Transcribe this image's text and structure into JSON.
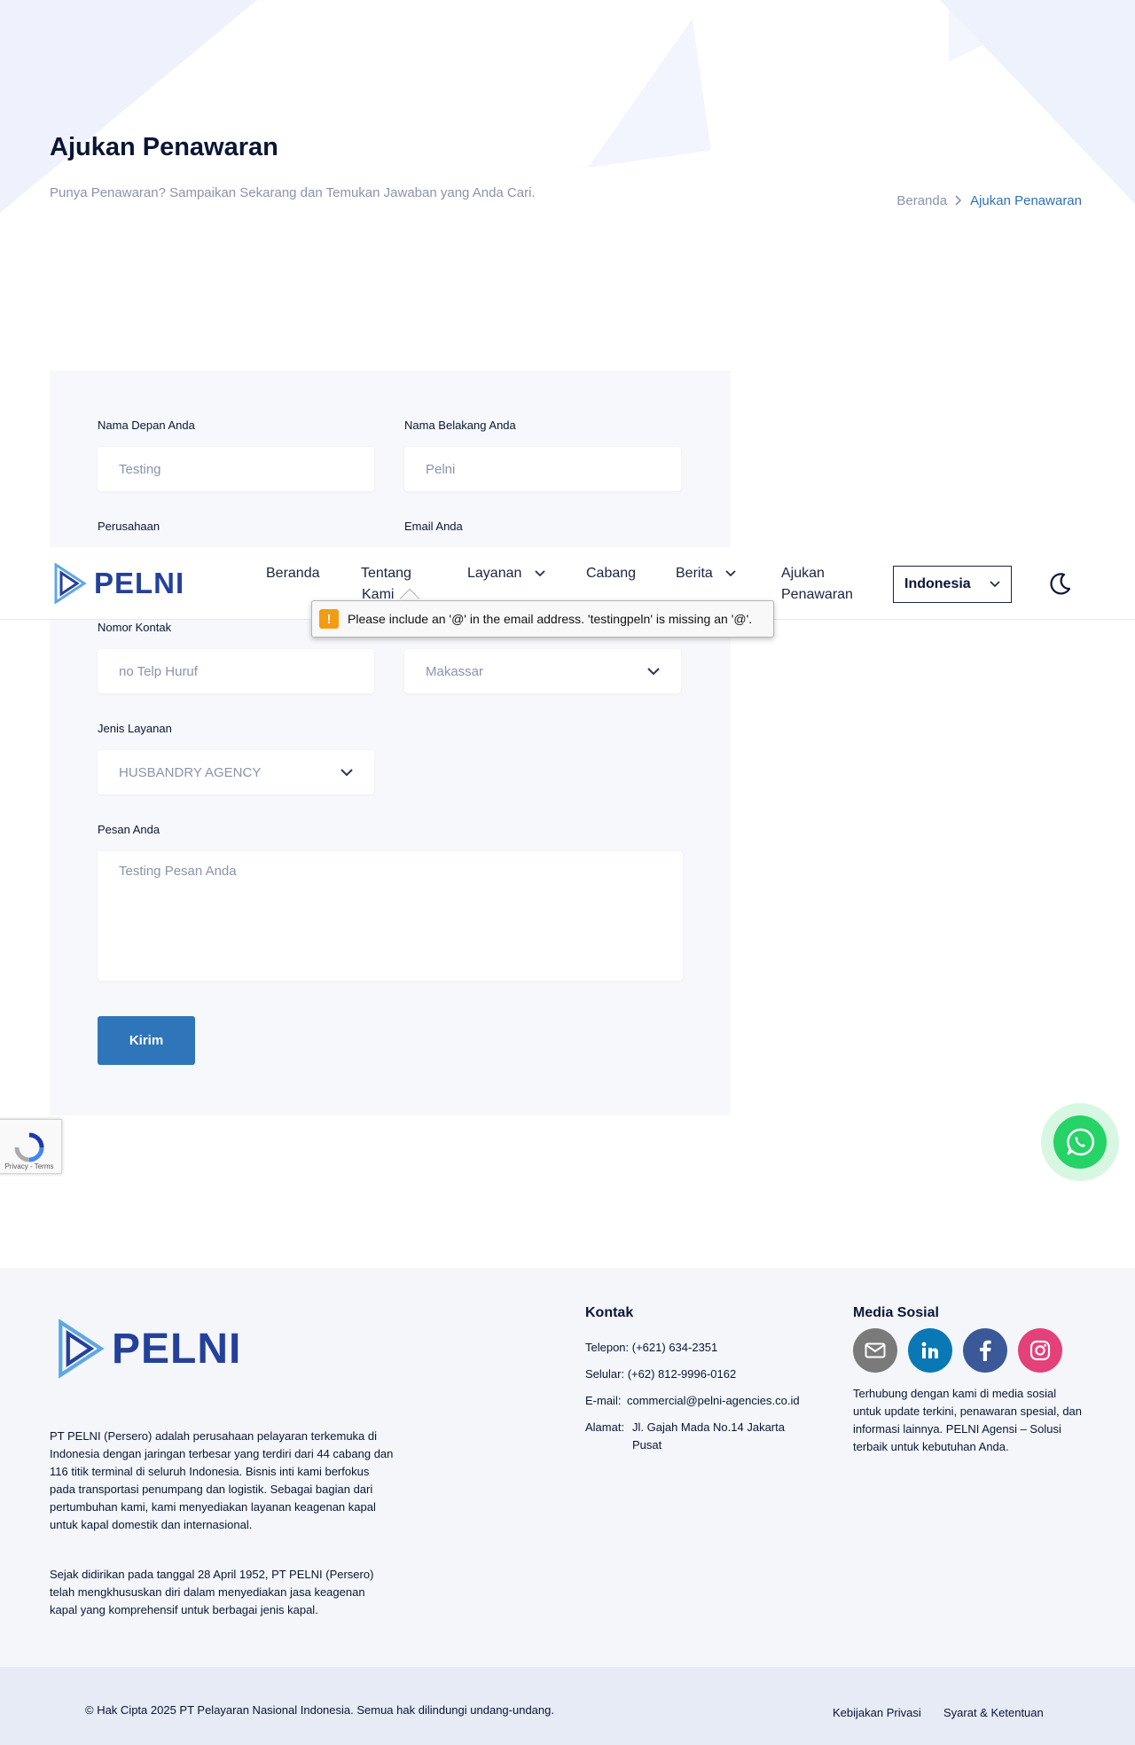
{
  "hero": {
    "title": "Ajukan Penawaran",
    "subtitle": "Punya Penawaran? Sampaikan Sekarang dan Temukan Jawaban yang Anda Cari.",
    "breadcrumb": {
      "home": "Beranda",
      "current": "Ajukan Penawaran"
    }
  },
  "form": {
    "first_name": {
      "label": "Nama Depan Anda",
      "value": "Testing"
    },
    "last_name": {
      "label": "Nama Belakang Anda",
      "value": "Pelni"
    },
    "company": {
      "label": "Perusahaan"
    },
    "email": {
      "label": "Email Anda"
    },
    "phone": {
      "label": "Nomor Kontak",
      "value": "no Telp Huruf"
    },
    "branch": {
      "value": "Makassar"
    },
    "service": {
      "label": "Jenis Layanan",
      "value": "HUSBANDRY AGENCY"
    },
    "message": {
      "label": "Pesan Anda",
      "value": "Testing Pesan Anda"
    },
    "submit_label": "Kirim"
  },
  "nav": {
    "logo_text": "PELNI",
    "items": {
      "home": "Beranda",
      "about_1": "Tentang",
      "about_2": "Kami",
      "services": "Layanan",
      "branches": "Cabang",
      "news": "Berita",
      "offer_1": "Ajukan",
      "offer_2": "Penawaran"
    },
    "language": "Indonesia"
  },
  "validation": {
    "message": "Please include an '@' in the email address. 'testingpeln' is missing an '@'."
  },
  "recaptcha": {
    "text": "Privacy - Terms"
  },
  "footer": {
    "logo_text": "PELNI",
    "desc_1": "PT PELNI (Persero) adalah perusahaan pelayaran terkemuka di Indonesia dengan jaringan terbesar yang terdiri dari 44 cabang dan 116 titik terminal di seluruh Indonesia. Bisnis inti kami berfokus pada transportasi penumpang dan logistik. Sebagai bagian dari pertumbuhan kami, kami menyediakan layanan keagenan kapal untuk kapal domestik dan internasional.",
    "desc_2": "Sejak didirikan pada tanggal 28 April 1952, PT PELNI (Persero) telah mengkhususkan diri dalam menyediakan jasa keagenan kapal yang komprehensif untuk berbagai jenis kapal.",
    "contact": {
      "heading": "Kontak",
      "phone": "Telepon: (+621) 634-2351",
      "mobile": "Selular: (+62) 812-9996-0162",
      "email_label": "E-mail:",
      "email": "commercial@pelni-agencies.co.id",
      "address_label": "Alamat:",
      "address_1": "Jl. Gajah Mada No.14 Jakarta",
      "address_2": "Pusat"
    },
    "social": {
      "heading": "Media Sosial",
      "desc": "Terhubung dengan kami di media sosial untuk update terkini, penawaran spesial, dan informasi lainnya. PELNI Agensi – Solusi terbaik untuk kebutuhan Anda."
    },
    "copyright": "© Hak Cipta 2025 PT Pelayaran Nasional Indonesia. Semua hak dilindungi undang-undang.",
    "privacy": "Kebijakan Privasi",
    "terms": "Syarat & Ketentuan"
  },
  "colors": {
    "primary": "#2f75b9",
    "brand_blue": "#24419a",
    "whatsapp": "#25d366",
    "warning": "#f39c12"
  }
}
